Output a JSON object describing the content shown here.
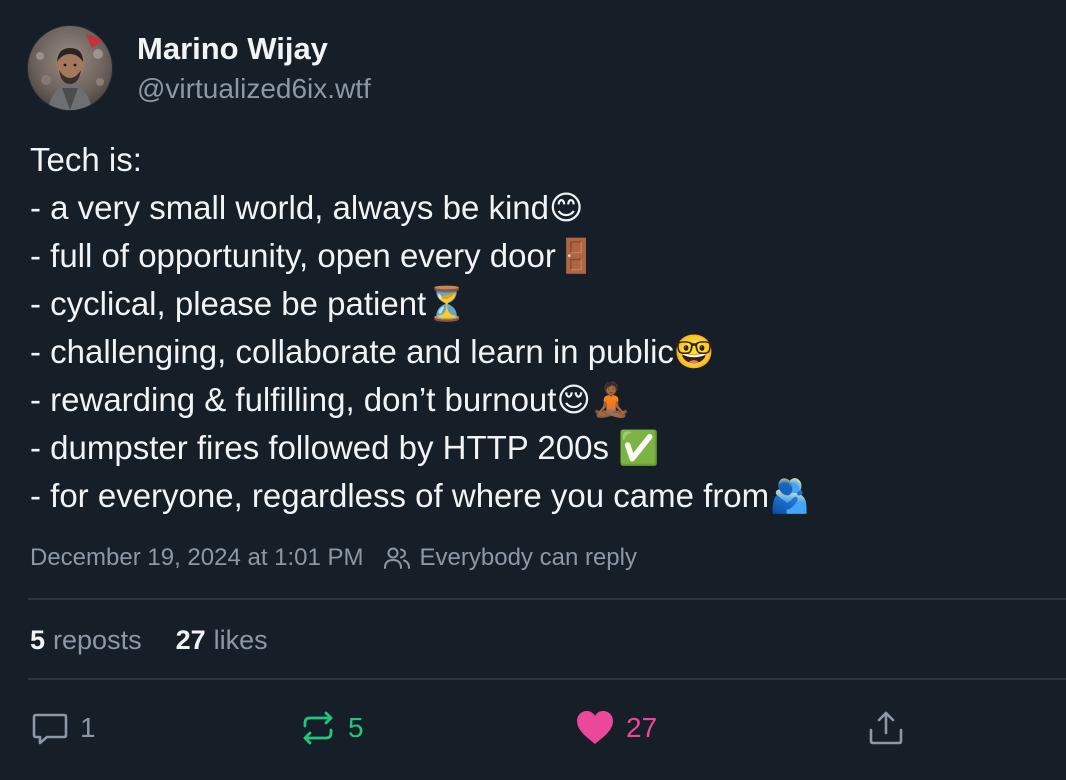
{
  "author": {
    "display_name": "Marino Wijay",
    "handle": "@virtualized6ix.wtf"
  },
  "post": {
    "lines": [
      "Tech is:",
      "- a very small world, always be kind😊",
      "- full of opportunity, open every door🚪",
      "- cyclical, please be patient⏳",
      "- challenging, collaborate and learn in public🤓",
      "- rewarding & fulfilling, don’t burnout😌🧘🏾",
      "- dumpster fires followed by HTTP 200s ✅",
      "- for everyone, regardless of where you came from🫂"
    ],
    "timestamp": "December 19, 2024 at 1:01 PM",
    "reply_setting": "Everybody can reply"
  },
  "stats": {
    "reposts_count": "5",
    "reposts_label": "reposts",
    "likes_count": "27",
    "likes_label": "likes"
  },
  "actions": {
    "reply_count": "1",
    "repost_count": "5",
    "like_count": "27"
  },
  "colors": {
    "background": "#161e27",
    "text_primary": "#f1f3f5",
    "text_secondary": "#8b98a5",
    "divider": "#2b3541",
    "repost_active": "#20c77a",
    "like_active": "#ec4899"
  },
  "icons": {
    "people": "people-icon",
    "reply": "comment-bubble-icon",
    "repost": "repost-arrows-icon",
    "like": "heart-icon",
    "share": "share-upload-icon"
  }
}
